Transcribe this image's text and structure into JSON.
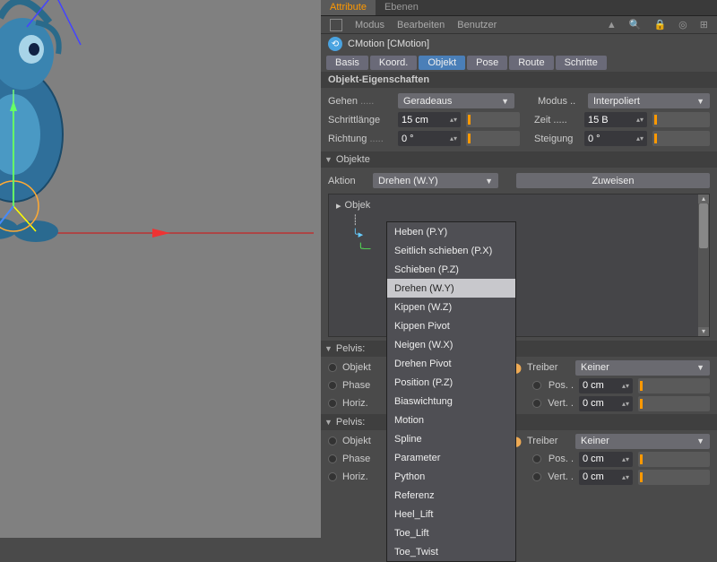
{
  "top_tabs": {
    "attribute": "Attribute",
    "ebenen": "Ebenen"
  },
  "menubar": {
    "modus": "Modus",
    "bearbeiten": "Bearbeiten",
    "benutzer": "Benutzer"
  },
  "object_title": "CMotion [CMotion]",
  "sub_tabs": {
    "basis": "Basis",
    "koord": "Koord.",
    "objekt": "Objekt",
    "pose": "Pose",
    "route": "Route",
    "schritte": "Schritte"
  },
  "section_header": "Objekt-Eigenschaften",
  "gehen": {
    "label": "Gehen",
    "value": "Geradeaus"
  },
  "modus_row": {
    "label": "Modus",
    "value": "Interpoliert"
  },
  "schrittlaenge": {
    "label": "Schrittlänge",
    "value": "15 cm"
  },
  "zeit": {
    "label": "Zeit",
    "value": "15 B"
  },
  "richtung": {
    "label": "Richtung",
    "value": "0 °"
  },
  "steigung": {
    "label": "Steigung",
    "value": "0 °"
  },
  "objekte_header": "Objekte",
  "aktion": {
    "label": "Aktion",
    "value": "Drehen (W.Y)"
  },
  "zuweisen_btn": "Zuweisen",
  "objlist_top": "Objek",
  "dropdown_items": [
    "Heben (P.Y)",
    "Seitlich schieben (P.X)",
    "Schieben (P.Z)",
    "Drehen (W.Y)",
    "Kippen (W.Z)",
    "Kippen Pivot",
    "Neigen (W.X)",
    "Drehen Pivot",
    "Position (P.Z)",
    "Biaswichtung",
    "Motion",
    "Spline",
    "Parameter",
    "Python",
    "Referenz",
    "Heel_Lift",
    "Toe_Lift",
    "Toe_Twist"
  ],
  "dropdown_selected_index": 3,
  "pelvis_sections": [
    {
      "header": "Pelvis:",
      "objekt_label": "Objekt",
      "treiber_label": "Treiber",
      "treiber_value": "Keiner",
      "phase_label": "Phase",
      "pos_label": "Pos.",
      "pos_value": "0 cm",
      "horiz_label": "Horiz.",
      "vert_label": "Vert.",
      "vert_value": "0 cm"
    },
    {
      "header": "Pelvis:",
      "objekt_label": "Objekt",
      "treiber_label": "Treiber",
      "treiber_value": "Keiner",
      "phase_label": "Phase",
      "pos_label": "Pos.",
      "pos_value": "0 cm",
      "horiz_label": "Horiz.",
      "vert_label": "Vert.",
      "vert_value": "0 cm"
    }
  ]
}
